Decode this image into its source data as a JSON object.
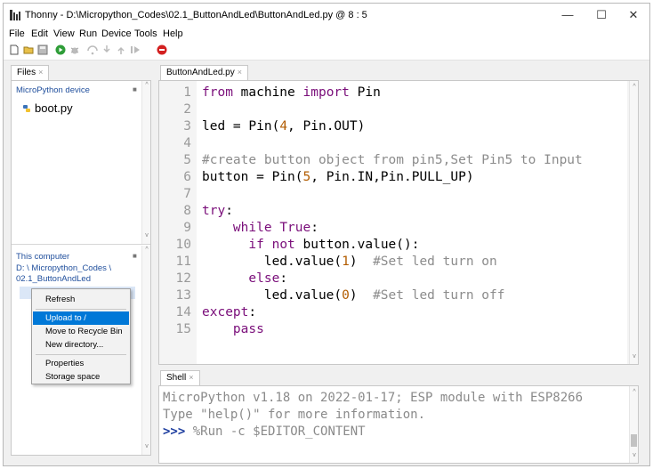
{
  "window": {
    "title": "Thonny  -  D:\\Micropython_Codes\\02.1_ButtonAndLed\\ButtonAndLed.py  @  8 : 5",
    "minimize": "—",
    "maximize": "☐",
    "close": "✕"
  },
  "menu": [
    "File",
    "Edit",
    "View",
    "Run",
    "Device",
    "Tools",
    "Help"
  ],
  "toolbar": [
    "new-file-icon",
    "open-folder-icon",
    "save-icon",
    "run-icon",
    "debug-icon",
    "step-over-icon",
    "step-into-icon",
    "step-out-icon",
    "resume-icon",
    "stop-icon"
  ],
  "files": {
    "tab_label": "Files",
    "device_title": "MicroPython device",
    "device_files": [
      "boot.py"
    ],
    "computer_title": "This computer",
    "computer_path": [
      "D: \\ Micropython_Codes \\",
      "02.1_ButtonAndLed"
    ]
  },
  "context_menu": {
    "items": [
      {
        "label": "Refresh"
      },
      {
        "label": "Upload to /"
      },
      {
        "label": "Move to Recycle Bin"
      },
      {
        "label": "New directory..."
      },
      {
        "label": "Properties"
      },
      {
        "label": "Storage space"
      }
    ]
  },
  "editor": {
    "tab_label": "ButtonAndLed.py",
    "line_numbers": [
      "1",
      "2",
      "3",
      "4",
      "5",
      "6",
      "7",
      "8",
      "9",
      "10",
      "11",
      "12",
      "13",
      "14",
      "15"
    ]
  },
  "shell": {
    "tab_label": "Shell",
    "lines": [
      "MicroPython v1.18 on 2022-01-17; ESP module with ESP8266",
      "Type \"help()\" for more information."
    ],
    "prompt": ">>>",
    "command": " %Run -c $EDITOR_CONTENT"
  },
  "code_tokens": {
    "l1": [
      "from",
      " machine ",
      "import",
      " Pin"
    ],
    "l3": [
      "led = Pin(",
      "4",
      ", Pin.OUT)"
    ],
    "l5": [
      "#create button object from pin5,Set Pin5 to Input"
    ],
    "l6": [
      "button = Pin(",
      "5",
      ", Pin.IN,Pin.PULL_UP)"
    ],
    "l8": [
      "try",
      ":"
    ],
    "l9": [
      "    ",
      "while",
      " ",
      "True",
      ":"
    ],
    "l10": [
      "      ",
      "if",
      " ",
      "not",
      " button.value():"
    ],
    "l11": [
      "        led.value(",
      "1",
      ")  ",
      "#Set led turn on"
    ],
    "l12": [
      "      ",
      "else",
      ":"
    ],
    "l13": [
      "        led.value(",
      "0",
      ")  ",
      "#Set led turn off"
    ],
    "l14": [
      "except",
      ":"
    ],
    "l15": [
      "    ",
      "pass"
    ]
  },
  "colors": {
    "keyword": "#7a0e7a",
    "number": "#b25c00",
    "comment": "#8c8c8c",
    "selection": "#0078d7",
    "prompt": "#1f3fa0"
  }
}
